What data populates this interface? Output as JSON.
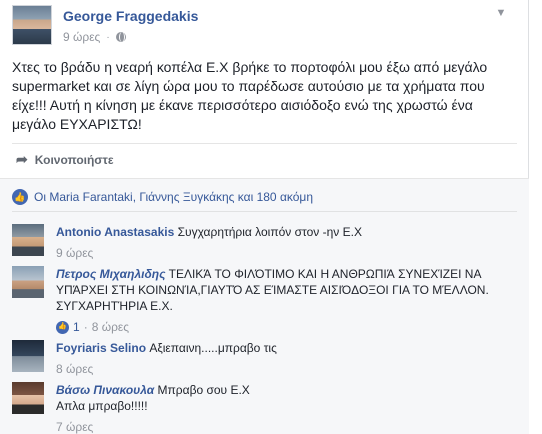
{
  "post": {
    "author": "George Fraggedakis",
    "time": "9 ώρες",
    "separator": "·",
    "text": "Χτες το βράδυ η νεαρή κοπέλα Ε.Χ βρήκε το πορτοφόλι μου έξω από μεγάλο\nsupermarket και σε λίγη ώρα μου το παρέδωσε αυτούσιο με τα χρήματα που\nείχε!!! Αυτή η κίνηση με έκανε περισσότερο αισιόδοξο ενώ της χρωστώ ένα\nμεγάλο ΕΥΧΑΡΙΣΤΩ!"
  },
  "actions": {
    "share_label": "Κοινοποιήστε"
  },
  "likes": {
    "text": "Οι Maria Farantaki, Γιάννης Ξυγκάκης και 180 ακόμη"
  },
  "comments": [
    {
      "name": "Antonio Anastasakis",
      "text": "Συγχαρητήρια λοιπόν στον -ην Ε.Χ",
      "time": "9 ώρες"
    },
    {
      "name": "Πετρος Μιχαηλιδης",
      "text": "ΤΕΛΙΚΆ ΤΟ ΦΙΛΌΤΙΜΟ ΚΑΙ Η ΑΝΘΡΩΠΙΆ ΣΥΝΕΧΊΖΕΙ ΝΑ ΥΠΆΡΧΕΙ ΣΤΗ ΚΟΙΝΩΝΊΑ,ΓΙΑΥΤΌ ΑΣ ΕΊΜΑΣΤΕ ΑΙΣΙΌΔΟΞΟΙ ΓΙΑ ΤΟ ΜΈΛΛΟΝ. ΣΥΓΧΑΡΗΤΉΡΙΑ Ε.Χ.",
      "likes": "1",
      "time": "8 ώρες"
    },
    {
      "name": "Foyriaris Selino",
      "text": "Αξιεπαινη.....μπραβο τις",
      "time": "8 ώρες"
    },
    {
      "name": "Βάσω Πινακουλα",
      "text": "Μπραβο σου Ε.Χ",
      "text2": "Απλα μπραβο!!!!!",
      "time": "7 ώρες"
    }
  ],
  "icons": {
    "menu": "chevron-down-icon",
    "privacy": "globe-icon",
    "share": "share-arrow-icon",
    "like": "thumbs-up-icon"
  },
  "colors": {
    "link": "#365899",
    "like_badge": "#4267b2",
    "muted": "#90949c"
  }
}
